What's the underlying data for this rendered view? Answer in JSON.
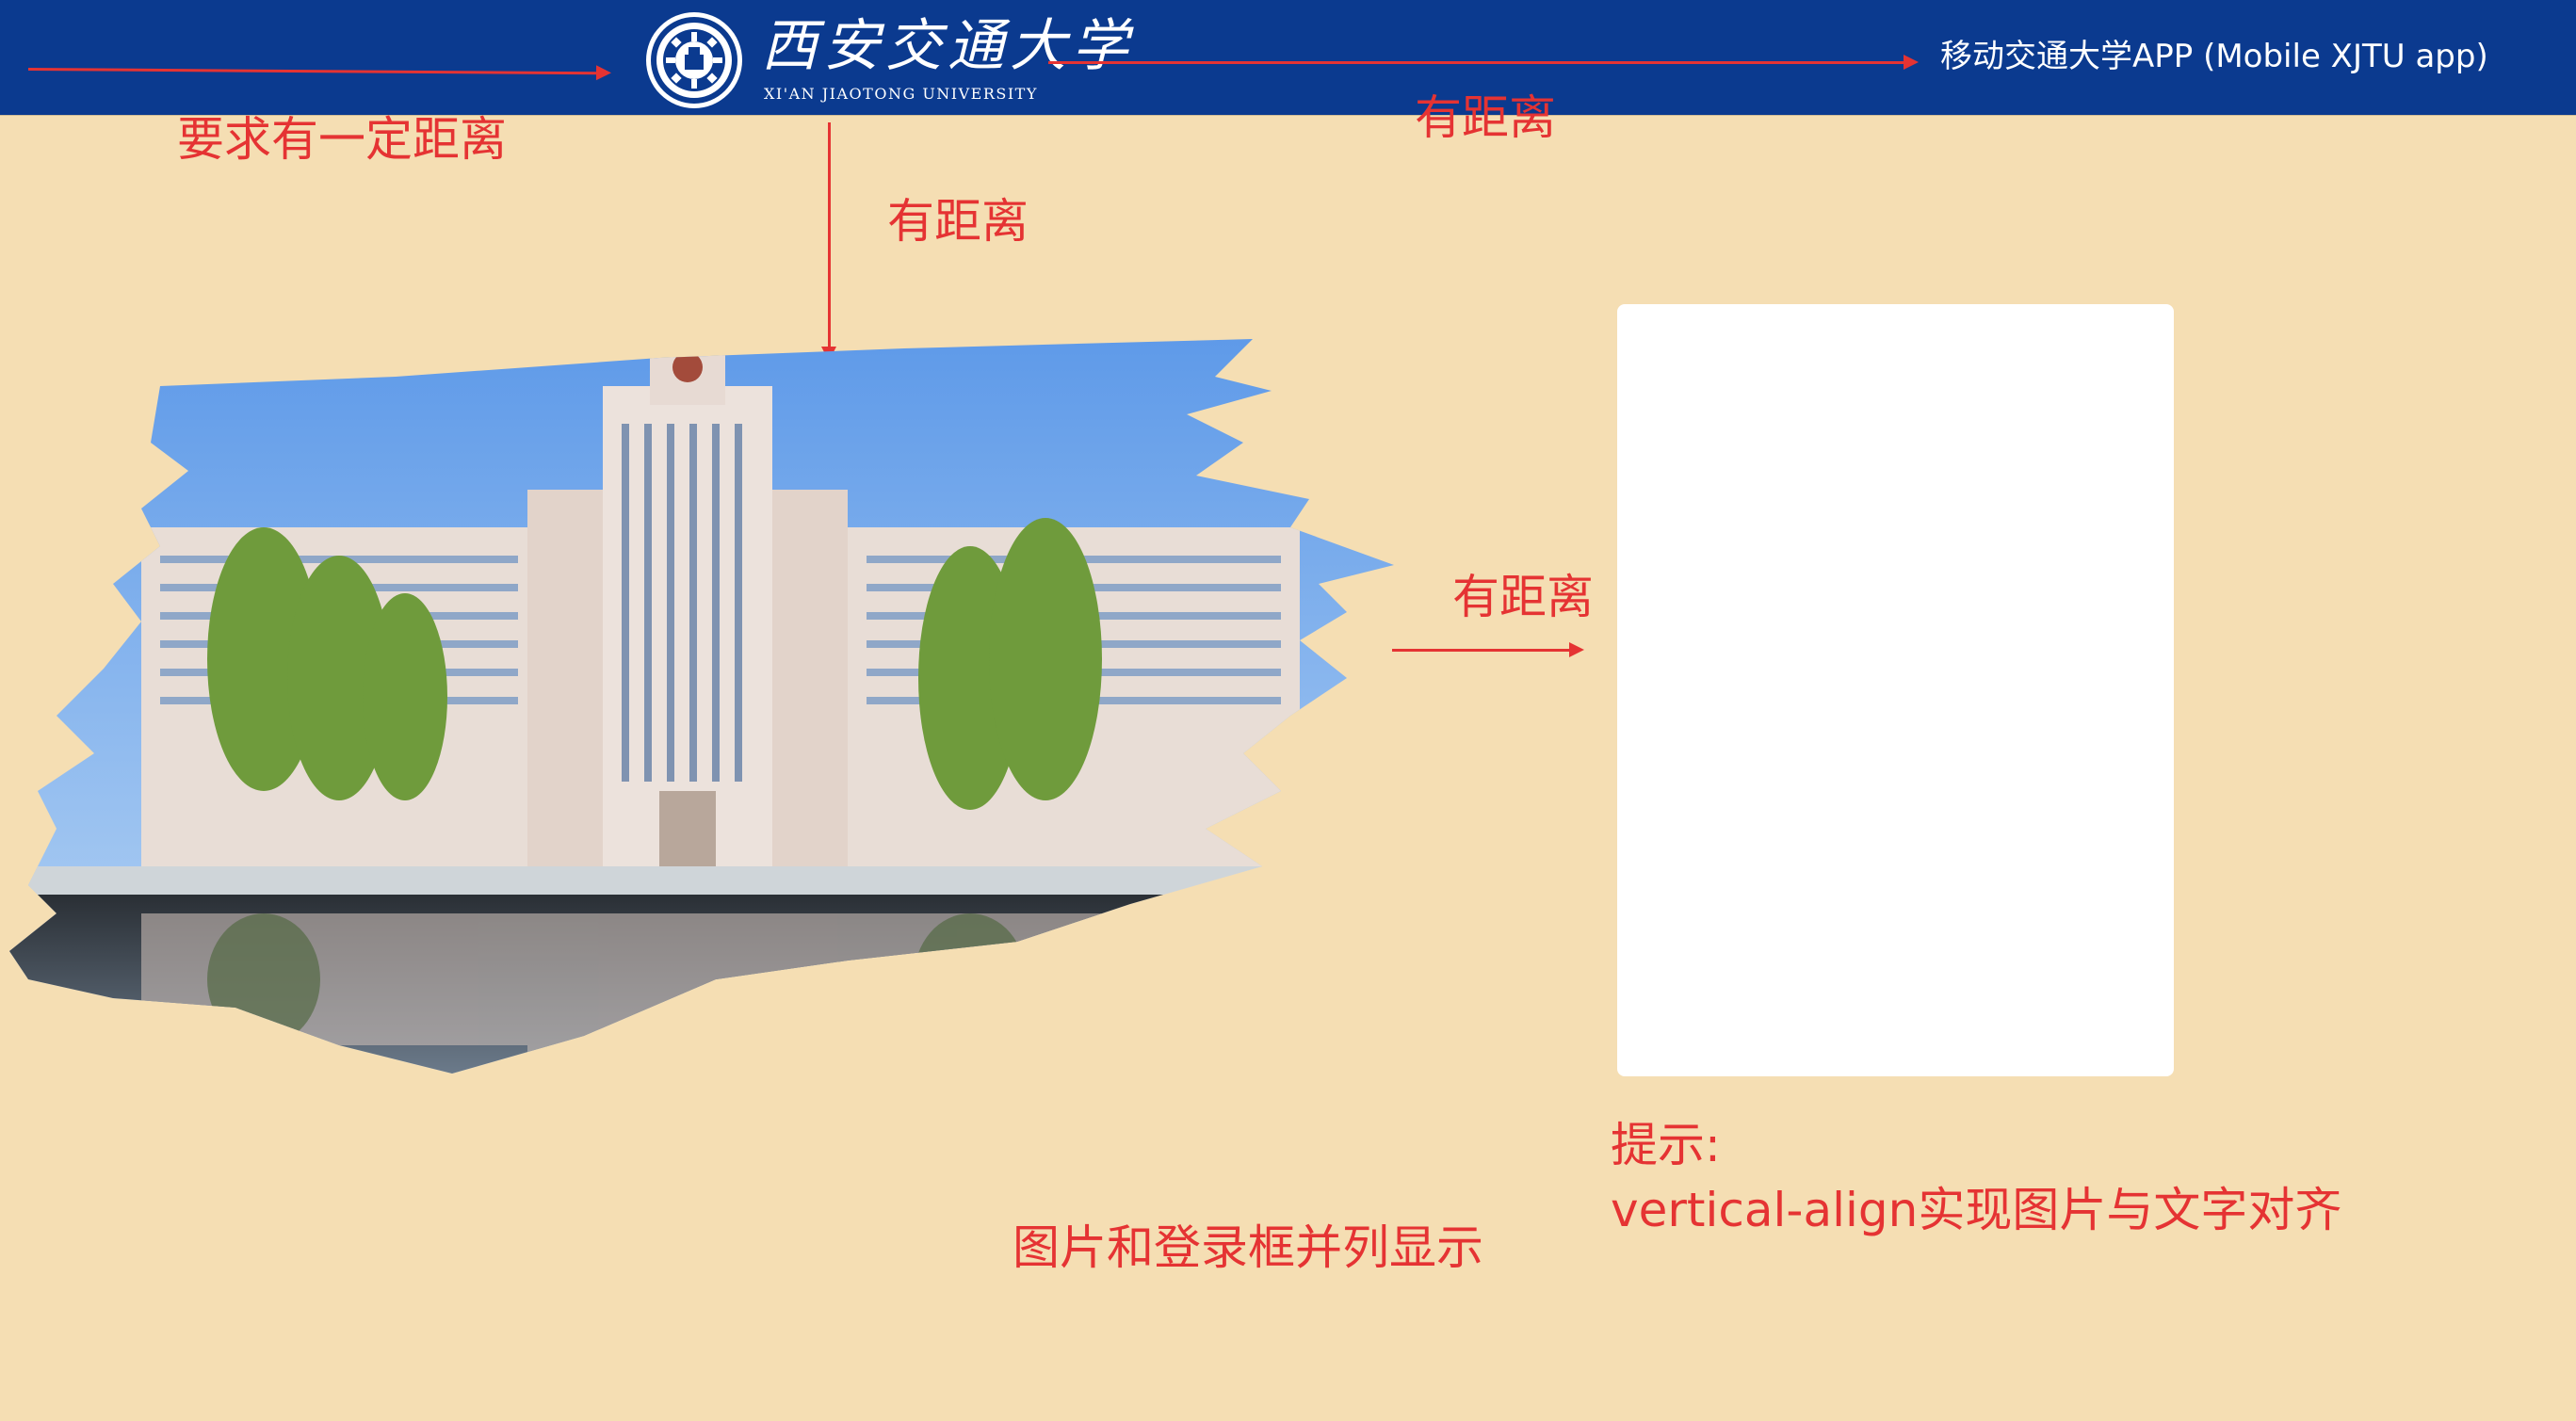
{
  "header": {
    "university_name_cn": "西安交通大学",
    "university_name_en": "XI'AN JIAOTONG UNIVERSITY",
    "app_link_label": "移动交通大学APP (Mobile XJTU app)",
    "background_color": "#0b3a8f"
  },
  "annotations": {
    "left_gap": "要求有一定距离",
    "right_gap": "有距离",
    "top_gap": "有距离",
    "middle_gap": "有距离",
    "side_by_side": "图片和登录框并列显示",
    "tip_title": "提示:",
    "tip_body": "vertical-align实现图片与文字对齐",
    "color": "#e53333"
  },
  "campus_photo": {
    "icon": "campus-building-photo"
  },
  "login_box": {
    "background": "#ffffff"
  }
}
